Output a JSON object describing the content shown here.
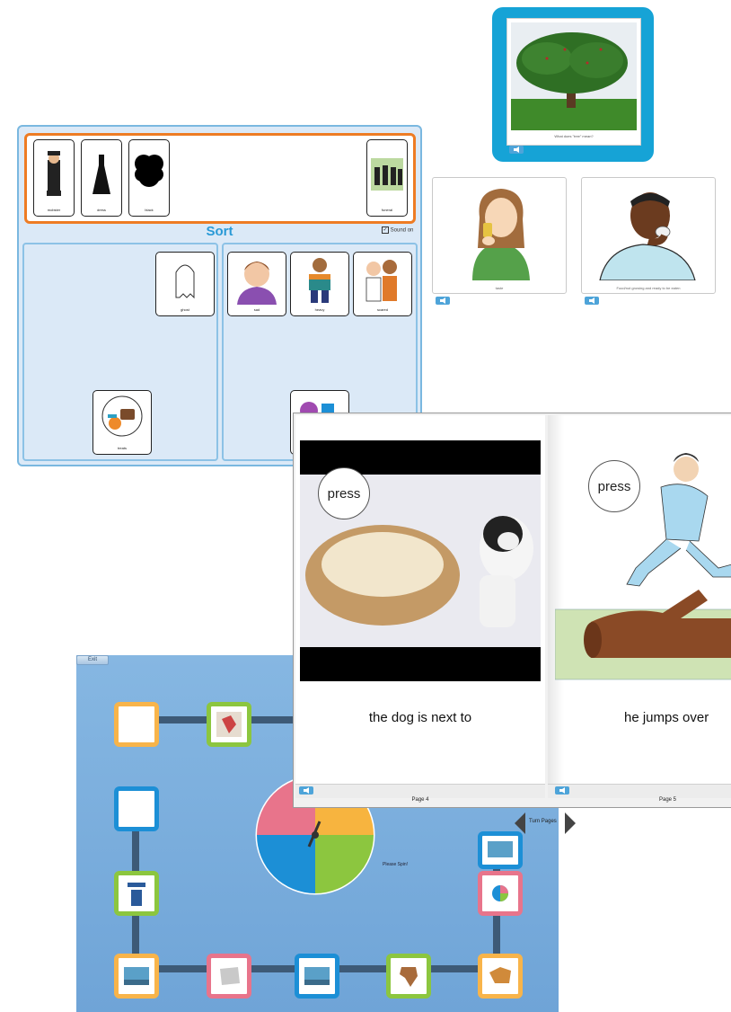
{
  "tree_card": {
    "caption": "What does \"tree\" mean?"
  },
  "eating_cards": [
    {
      "caption": "taste"
    },
    {
      "caption": "Food/not growing and ready to be eaten"
    }
  ],
  "sort_panel": {
    "title": "Sort",
    "sound_label": "Sound on",
    "top_symbols": [
      "mobster",
      "dress",
      "black",
      "funeral"
    ],
    "left_bin": [
      "ghost",
      "treats"
    ],
    "right_bin": [
      "sad",
      "heavy",
      "scared"
    ]
  },
  "book": {
    "left": {
      "button": "press",
      "text": "the dog is next to",
      "page": "Page 4"
    },
    "right": {
      "button": "press",
      "text": "he jumps over",
      "page": "Page 5"
    },
    "turn_label": "Turn Pages"
  },
  "game": {
    "exit_label": "Exit",
    "spin_label": "Please Spin!",
    "spinner_colors": [
      "#e8748b",
      "#f7b43f",
      "#1c8fd6",
      "#8cc63f"
    ]
  }
}
